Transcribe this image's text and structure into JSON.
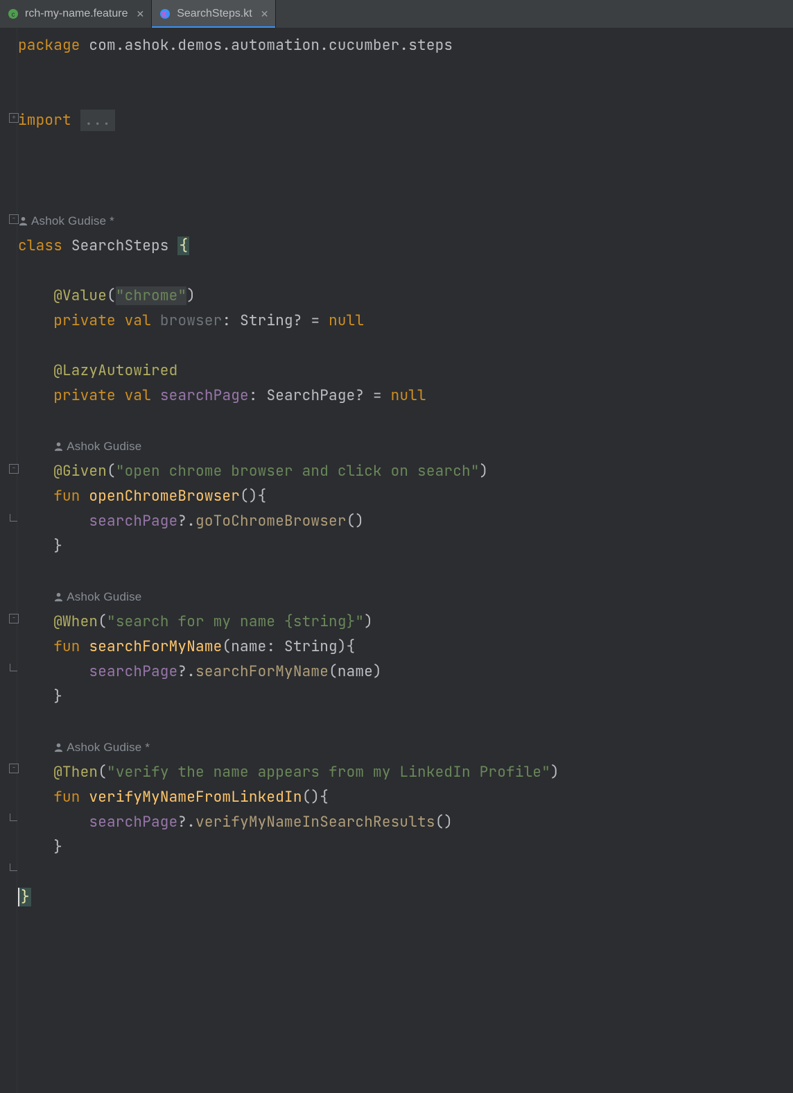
{
  "tabs": [
    {
      "label": "rch-my-name.feature",
      "active": false
    },
    {
      "label": "SearchSteps.kt",
      "active": true
    }
  ],
  "code": {
    "packageKw": "package",
    "packageName": "com.ashok.demos.automation.cucumber.steps",
    "importKw": "import",
    "importEllipsis": "...",
    "classAuthor": "Ashok Gudise *",
    "classKw": "class",
    "className": "SearchSteps",
    "valueAnn": "@Value",
    "valueStr": "\"chrome\"",
    "privateKw": "private",
    "valKw": "val",
    "browserField": "browser",
    "stringType": "String",
    "nullKw": "null",
    "lazyAnn": "@LazyAutowired",
    "searchPageField": "searchPage",
    "searchPageType": "SearchPage",
    "author2": "Ashok Gudise",
    "givenAnn": "@Given",
    "givenStr": "\"open chrome browser and click on search\"",
    "funKw": "fun",
    "openFn": "openChromeBrowser",
    "goToMethod": "goToChromeBrowser",
    "author3": "Ashok Gudise",
    "whenAnn": "@When",
    "whenStr": "\"search for my name {string}\"",
    "searchFn": "searchForMyName",
    "paramName": "name",
    "searchMethod": "searchForMyName",
    "author4": "Ashok Gudise *",
    "thenAnn": "@Then",
    "thenStr": "\"verify the name appears from my LinkedIn Profile\"",
    "verifyFn": "verifyMyNameFromLinkedIn",
    "verifyMethod": "verifyMyNameInSearchResults"
  }
}
